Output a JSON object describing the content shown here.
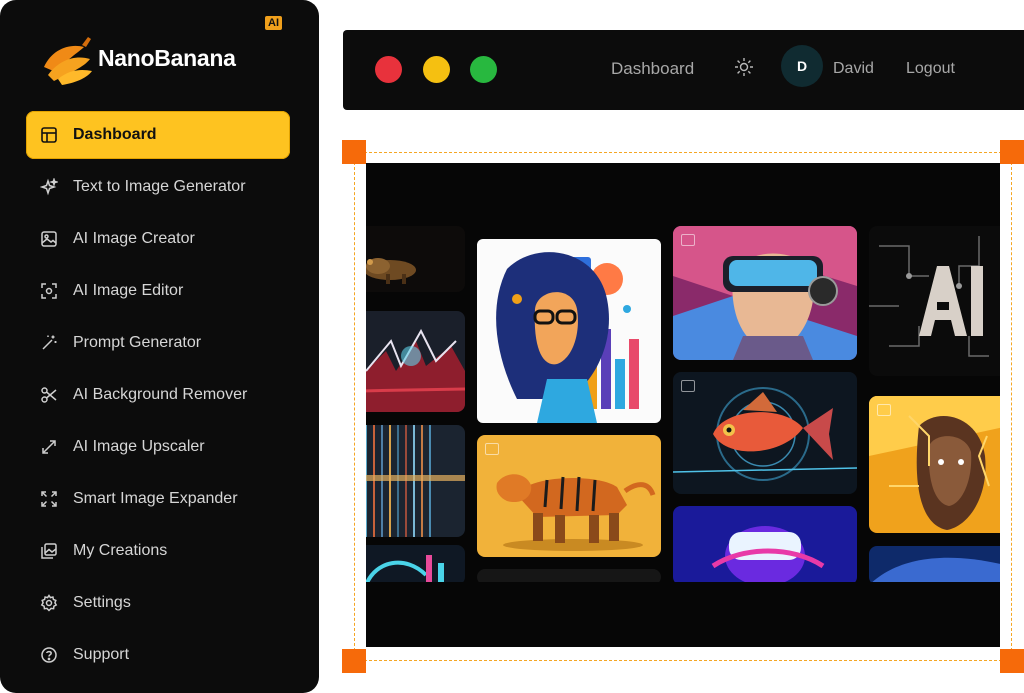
{
  "app": {
    "brand": "NanoBanana",
    "badge": "AI"
  },
  "colors": {
    "accent": "#fec320",
    "handle": "#f66a0a",
    "frame": "#f5a623",
    "sidebar_bg": "#0c0c0c"
  },
  "sidebar": {
    "items": [
      {
        "label": "Dashboard",
        "icon": "layout-icon",
        "active": true
      },
      {
        "label": "Text to Image Generator",
        "icon": "sparkles-icon"
      },
      {
        "label": "AI Image Creator",
        "icon": "image-icon"
      },
      {
        "label": "AI Image Editor",
        "icon": "scan-icon"
      },
      {
        "label": "Prompt Generator",
        "icon": "magic-wand-icon"
      },
      {
        "label": "AI Background Remover",
        "icon": "scissors-icon"
      },
      {
        "label": "AI Image Upscaler",
        "icon": "expand-arrows-icon"
      },
      {
        "label": "Smart Image Expander",
        "icon": "maximize-icon"
      },
      {
        "label": "My Creations",
        "icon": "gallery-icon"
      },
      {
        "label": "Settings",
        "icon": "gear-icon"
      },
      {
        "label": "Support",
        "icon": "help-circle-icon"
      }
    ]
  },
  "topbar": {
    "dashboard_label": "Dashboard",
    "theme_icon": "sun-icon",
    "avatar_initial": "D",
    "user_name": "David",
    "logout_label": "Logout"
  },
  "gallery": {
    "tiles": [
      {
        "name": "robot-leopard"
      },
      {
        "name": "neon-splash"
      },
      {
        "name": "data-lines"
      },
      {
        "name": "neon-cyan-partial"
      },
      {
        "name": "woman-glasses-illustration"
      },
      {
        "name": "robot-tiger"
      },
      {
        "name": "dark-placeholder"
      },
      {
        "name": "vr-headset-girl"
      },
      {
        "name": "neon-fish"
      },
      {
        "name": "vr-headset-neon"
      },
      {
        "name": "ai-circuit"
      },
      {
        "name": "cyborg-woman"
      },
      {
        "name": "blue-partial"
      }
    ]
  }
}
